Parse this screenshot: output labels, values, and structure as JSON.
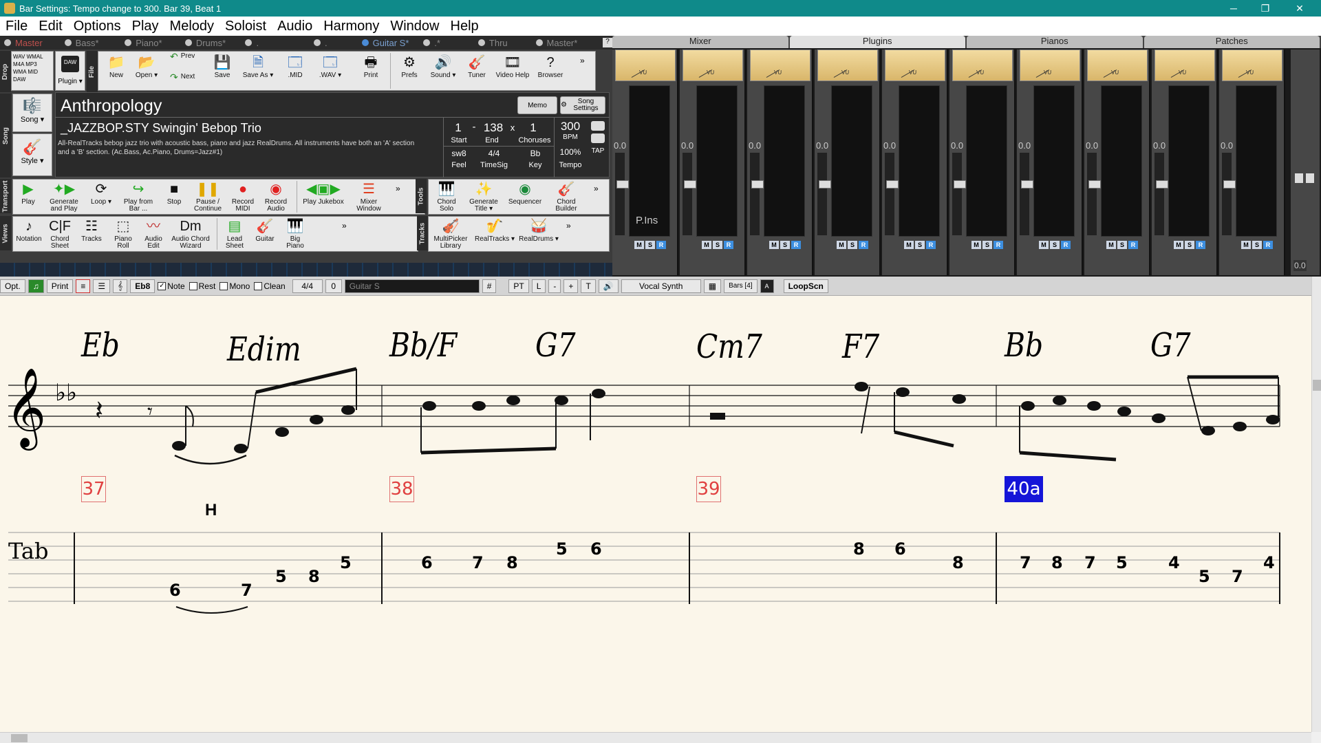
{
  "window": {
    "title": "Bar Settings: Tempo change to 300.   Bar 39, Beat 1",
    "min_icon": "minimize-icon",
    "max_icon": "maximize-icon",
    "close_icon": "close-icon"
  },
  "menu": [
    "File",
    "Edit",
    "Options",
    "Play",
    "Melody",
    "Soloist",
    "Audio",
    "Harmony",
    "Window",
    "Help"
  ],
  "tracks": [
    "Master",
    "Bass*",
    "Piano*",
    "Drums*",
    ".",
    ".",
    "Guitar S*",
    ".*",
    "Thru",
    "Master*"
  ],
  "file_buttons": [
    {
      "label": "New"
    },
    {
      "label": "Open ▾"
    },
    {
      "label": "Prev"
    },
    {
      "label": "Next"
    },
    {
      "label": "Save"
    },
    {
      "label": "Save As ▾"
    },
    {
      "label": ".MID"
    },
    {
      "label": ".WAV ▾"
    },
    {
      "label": "Print"
    },
    {
      "label": "Prefs"
    },
    {
      "label": "Sound ▾"
    },
    {
      "label": "Tuner"
    },
    {
      "label": "Video Help"
    },
    {
      "label": "Browser"
    }
  ],
  "drop_labels": [
    "WAV",
    "WMAL",
    "M4A",
    "MP3",
    "WMA",
    "MID",
    "DAW"
  ],
  "plugin_label": "Plugin ▾",
  "side_tabs": {
    "drop": "Drop",
    "song": "Song",
    "transport": "Transport",
    "views": "Views",
    "file": "File",
    "tools": "Tools",
    "tracks": "Tracks"
  },
  "song_btn": "Song ▾",
  "style_btn": "Style ▾",
  "song": {
    "title": "Anthropology",
    "memo": "Memo",
    "song_settings": "Song Settings",
    "style": "_JAZZBOP.STY Swingin' Bebop Trio",
    "desc": "All-RealTracks bebop jazz trio with acoustic bass, piano and jazz RealDrums. All instruments have both an 'A' section and a 'B' section.     (Ac.Bass, Ac.Piano, Drums=Jazz#1)",
    "start": "1",
    "dash": "-",
    "end": "138",
    "x": "x",
    "choruses": "1",
    "start_lbl": "Start",
    "end_lbl": "End",
    "choruses_lbl": "Choruses",
    "feel": "sw8",
    "timesig": "4/4",
    "key": "Bb",
    "feel_lbl": "Feel",
    "timesig_lbl": "TimeSig",
    "key_lbl": "Key",
    "tempo": "300",
    "bpm": "BPM",
    "tempo_pct": "100%",
    "tap": "TAP",
    "tempo_lbl": "Tempo"
  },
  "transport_buttons": [
    {
      "label": "Play"
    },
    {
      "label": "Generate and Play"
    },
    {
      "label": "Loop ▾"
    },
    {
      "label": "Play from Bar ..."
    },
    {
      "label": "Stop"
    },
    {
      "label": "Pause / Continue"
    },
    {
      "label": "Record MIDI"
    },
    {
      "label": "Record Audio"
    },
    {
      "label": "Play Jukebox"
    },
    {
      "label": "Mixer Window"
    }
  ],
  "tools_buttons": [
    {
      "label": "Chord Solo"
    },
    {
      "label": "Generate Title ▾"
    },
    {
      "label": "Sequencer"
    },
    {
      "label": "Chord Builder"
    }
  ],
  "views_buttons": [
    {
      "label": "Notation"
    },
    {
      "label": "Chord Sheet"
    },
    {
      "label": "Tracks"
    },
    {
      "label": "Piano Roll"
    },
    {
      "label": "Audio Edit"
    },
    {
      "label": "Audio Chord Wizard"
    },
    {
      "label": "Lead Sheet"
    },
    {
      "label": "Guitar"
    },
    {
      "label": "Big Piano"
    }
  ],
  "tracks_buttons": [
    {
      "label": "MultiPicker Library"
    },
    {
      "label": "RealTracks ▾"
    },
    {
      "label": "RealDrums ▾"
    }
  ],
  "more": "»",
  "mixer": {
    "tabs": [
      "Mixer",
      "Plugins",
      "Pianos",
      "Patches"
    ],
    "strip_value": "0.0",
    "vu_label": "VU",
    "pins": "P.Ins",
    "m": "M",
    "s": "S",
    "r": "R",
    "strips": 10
  },
  "notation_bar": {
    "opt": "Opt.",
    "print": "Print",
    "key": "Eb8",
    "note": "Note",
    "rest": "Rest",
    "mono": "Mono",
    "clean": "Clean",
    "timesig": "4/4",
    "zero": "0",
    "track": "Guitar S",
    "sharp": "#",
    "pt": "PT",
    "l": "L",
    "minus": "-",
    "plus": "+",
    "t": "T",
    "vocal": "Vocal Synth",
    "bars": "Bars [4]",
    "loopscn": "LoopScn"
  },
  "score": {
    "chords": [
      "Eb",
      "Edim",
      "Bb/F",
      "G7",
      "Cm7",
      "F7",
      "Bb",
      "G7"
    ],
    "bars": [
      "37",
      "38",
      "39",
      "40a"
    ],
    "annotation": "H",
    "tab_label": "Tab",
    "tab_numbers": [
      "6",
      "7",
      "5",
      "8",
      "5",
      "6",
      "7",
      "8",
      "5",
      "6",
      "8",
      "6",
      "8",
      "7",
      "8",
      "7",
      "5",
      "4",
      "5",
      "7",
      "4"
    ]
  }
}
